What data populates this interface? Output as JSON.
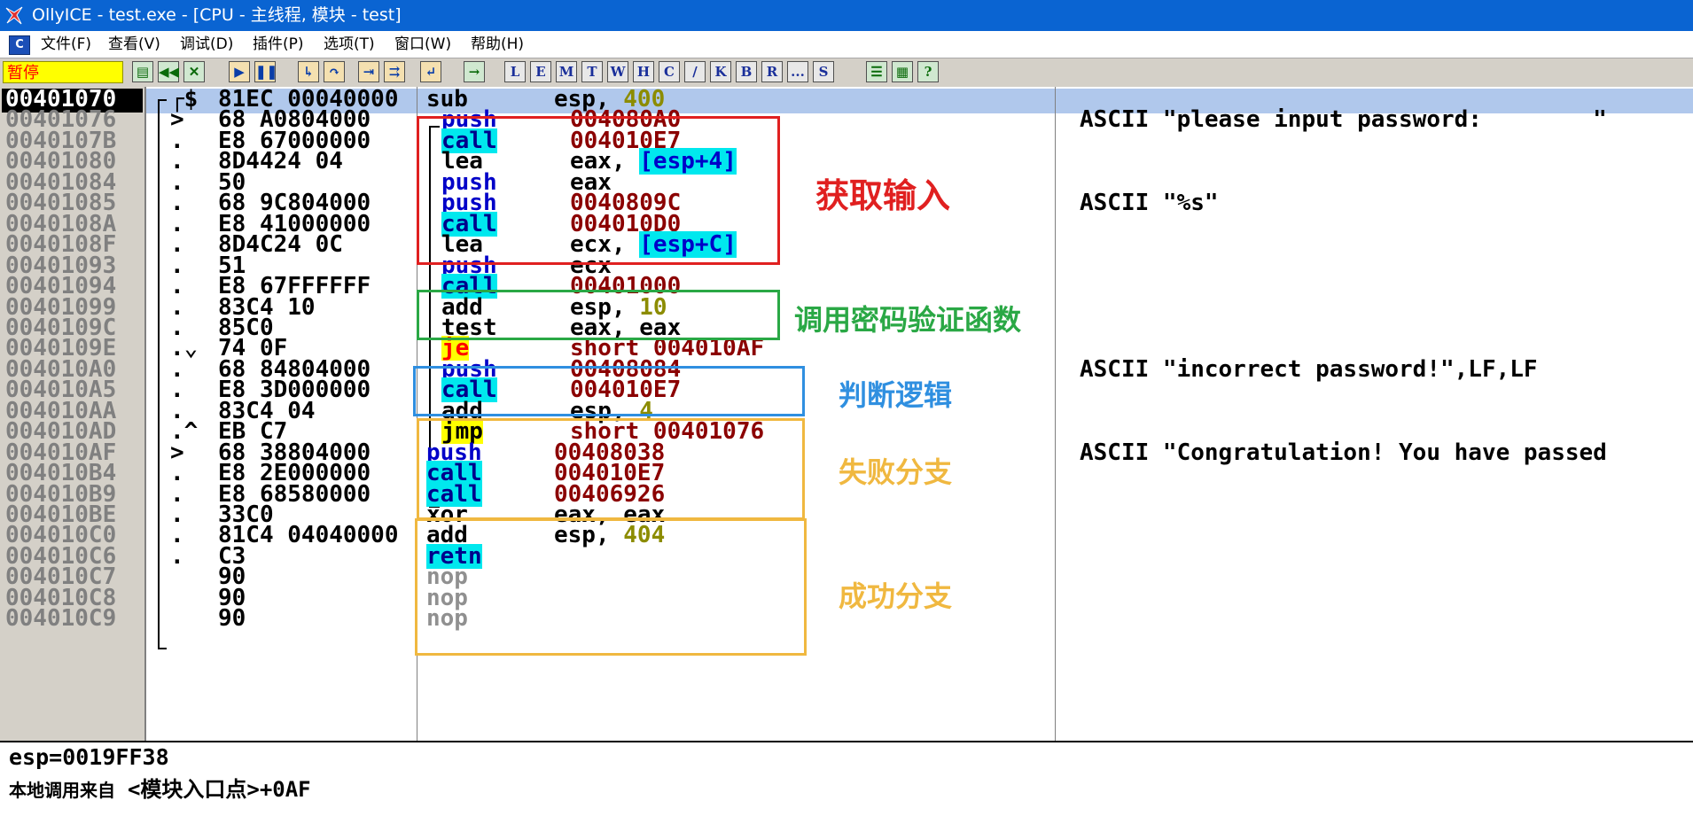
{
  "window": {
    "title": "OllyICE - test.exe - [CPU - 主线程, 模块 - test]"
  },
  "menu": {
    "app_icon": "C",
    "items": [
      "文件(F)",
      "查看(V)",
      "调试(D)",
      "插件(P)",
      "选项(T)",
      "窗口(W)",
      "帮助(H)"
    ]
  },
  "toolbar": {
    "status": "暂停",
    "letter_buttons": [
      "L",
      "E",
      "M",
      "T",
      "W",
      "H",
      "C",
      "/",
      "K",
      "B",
      "R",
      "...",
      "S"
    ]
  },
  "disasm": {
    "rows": [
      {
        "addr": "00401070",
        "glyph": "┌$",
        "hex": "81EC 00040000",
        "mn": "sub",
        "op": "esp, 400",
        "comment": ""
      },
      {
        "addr": "00401076",
        "glyph": ">",
        "hex": "68 A0804000",
        "mn": "push",
        "op": "004080A0",
        "comment": "ASCII \"please input password:        \""
      },
      {
        "addr": "0040107B",
        "glyph": ".",
        "hex": "E8 67000000",
        "mn": "call",
        "op": "004010E7",
        "comment": ""
      },
      {
        "addr": "00401080",
        "glyph": ".",
        "hex": "8D4424 04",
        "mn": "lea",
        "op": "eax, [esp+4]",
        "comment": ""
      },
      {
        "addr": "00401084",
        "glyph": ".",
        "hex": "50",
        "mn": "push",
        "op": "eax",
        "comment": ""
      },
      {
        "addr": "00401085",
        "glyph": ".",
        "hex": "68 9C804000",
        "mn": "push",
        "op": "0040809C",
        "comment": "ASCII \"%s\""
      },
      {
        "addr": "0040108A",
        "glyph": ".",
        "hex": "E8 41000000",
        "mn": "call",
        "op": "004010D0",
        "comment": ""
      },
      {
        "addr": "0040108F",
        "glyph": ".",
        "hex": "8D4C24 0C",
        "mn": "lea",
        "op": "ecx, [esp+C]",
        "comment": ""
      },
      {
        "addr": "00401093",
        "glyph": ".",
        "hex": "51",
        "mn": "push",
        "op": "ecx",
        "comment": ""
      },
      {
        "addr": "00401094",
        "glyph": ".",
        "hex": "E8 67FFFFFF",
        "mn": "call",
        "op": "00401000",
        "comment": ""
      },
      {
        "addr": "00401099",
        "glyph": ".",
        "hex": "83C4 10",
        "mn": "add",
        "op": "esp, 10",
        "comment": ""
      },
      {
        "addr": "0040109C",
        "glyph": ".",
        "hex": "85C0",
        "mn": "test",
        "op": "eax, eax",
        "comment": ""
      },
      {
        "addr": "0040109E",
        "glyph": ".⌄",
        "hex": "74 0F",
        "mn": "je",
        "op": "short 004010AF",
        "comment": ""
      },
      {
        "addr": "004010A0",
        "glyph": ".",
        "hex": "68 84804000",
        "mn": "push",
        "op": "00408084",
        "comment": "ASCII \"incorrect password!\",LF,LF"
      },
      {
        "addr": "004010A5",
        "glyph": ".",
        "hex": "E8 3D000000",
        "mn": "call",
        "op": "004010E7",
        "comment": ""
      },
      {
        "addr": "004010AA",
        "glyph": ".",
        "hex": "83C4 04",
        "mn": "add",
        "op": "esp, 4",
        "comment": ""
      },
      {
        "addr": "004010AD",
        "glyph": ".^",
        "hex": "EB C7",
        "mn": "jmp",
        "op": "short 00401076",
        "comment": ""
      },
      {
        "addr": "004010AF",
        "glyph": ">",
        "hex": "68 38804000",
        "mn": "push",
        "op": "00408038",
        "comment": "ASCII \"Congratulation! You have passed"
      },
      {
        "addr": "004010B4",
        "glyph": ".",
        "hex": "E8 2E000000",
        "mn": "call",
        "op": "004010E7",
        "comment": ""
      },
      {
        "addr": "004010B9",
        "glyph": ".",
        "hex": "E8 68580000",
        "mn": "call",
        "op": "00406926",
        "comment": ""
      },
      {
        "addr": "004010BE",
        "glyph": ".",
        "hex": "33C0",
        "mn": "xor",
        "op": "eax, eax",
        "comment": ""
      },
      {
        "addr": "004010C0",
        "glyph": ".",
        "hex": "81C4 04040000",
        "mn": "add",
        "op": "esp, 404",
        "comment": ""
      },
      {
        "addr": "004010C6",
        "glyph": ".",
        "hex": "C3",
        "mn": "retn",
        "op": "",
        "comment": ""
      },
      {
        "addr": "004010C7",
        "glyph": "",
        "hex": "90",
        "mn": "nop",
        "op": "",
        "comment": ""
      },
      {
        "addr": "004010C8",
        "glyph": "",
        "hex": "90",
        "mn": "nop",
        "op": "",
        "comment": ""
      },
      {
        "addr": "004010C9",
        "glyph": "",
        "hex": "90",
        "mn": "nop",
        "op": "",
        "comment": ""
      }
    ]
  },
  "annotations": {
    "get_input": "获取输入",
    "call_verify": "调用密码验证函数",
    "judge_logic": "判断逻辑",
    "fail_branch": "失败分支",
    "success_branch": "成功分支"
  },
  "colors": {
    "get_input": "#e02020",
    "call_verify": "#2aa845",
    "judge_logic": "#2f8fe0",
    "fail_branch": "#f0b840",
    "success_branch": "#f0b840"
  },
  "info": {
    "line1": "esp=0019FF38",
    "line2_label": "本地调用来自",
    "line2_value": "<模块入口点>+0AF"
  }
}
